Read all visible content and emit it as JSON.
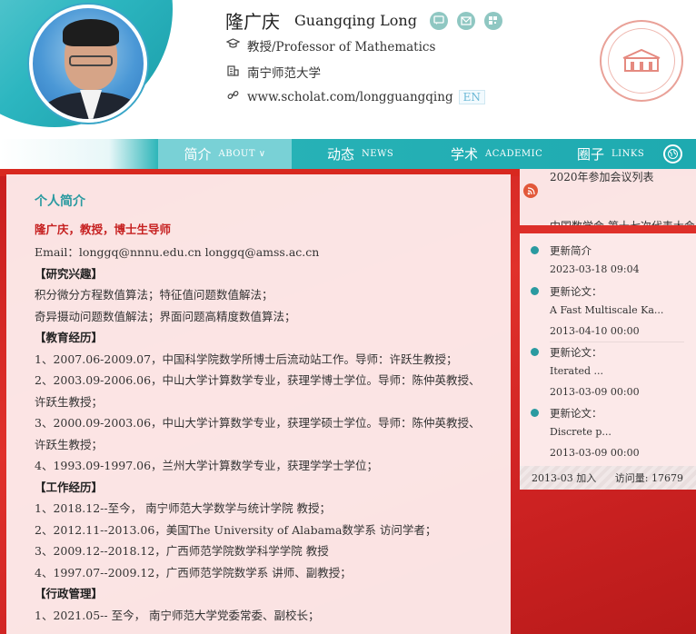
{
  "header": {
    "name_cn": "隆广庆",
    "name_en": "Guangqing Long",
    "icons": [
      "chat-icon",
      "mail-icon",
      "qrcode-icon"
    ],
    "title": "教授/Professor of Mathematics",
    "university": "南宁师范大学",
    "url": "www.scholat.com/longguangqing",
    "lang_tag": "EN"
  },
  "nav": {
    "items": [
      {
        "cn": "简介",
        "en": "ABOUT ∨"
      },
      {
        "cn": "动态",
        "en": "NEWS"
      },
      {
        "cn": "学术",
        "en": "ACADEMIC"
      },
      {
        "cn": "圈子",
        "en": "LINKS"
      }
    ]
  },
  "main": {
    "section_title": "个人简介",
    "intro_name": "隆广庆，教授，博士生导师",
    "email": "Email：longgq@nnnu.edu.cn   longgq@amss.ac.cn",
    "research_heading": "【研究兴趣】",
    "research": [
      "积分微分方程数值算法；特征值问题数值解法；",
      "奇异摄动问题数值解法；界面问题高精度数值算法；"
    ],
    "education_heading": "【教育经历】",
    "education": [
      "1、2007.06-2009.07，中国科学院数学所博士后流动站工作。导师：许跃生教授；",
      "2、2003.09-2006.06，中山大学计算数学专业，获理学博士学位。导师：陈仲英教授、许跃生教授；",
      "3、2000.09-2003.06，中山大学计算数学专业，获理学硕士学位。导师：陈仲英教授、许跃生教授；",
      "4、1993.09-1997.06，兰州大学计算数学专业，获理学学士学位；"
    ],
    "work_heading": "【工作经历】",
    "work": [
      "1、2018.12--至今，    南宁师范大学数学与统计学院 教授；",
      "2、2012.11--2013.06，美国The University of Alabama数学系 访问学者；",
      "3、2009.12--2018.12，广西师范学院数学科学学院  教授",
      "4、1997.07--2009.12，广西师范学院数学系  讲师、副教授；"
    ],
    "admin_heading": "【行政管理】",
    "admin": [
      "1、2021.05-- 至今，    南宁师范大学党委常委、副校长；"
    ]
  },
  "rss": {
    "item1": "2020年参加会议列表",
    "item2": "中国数学会 第十七次代表大会"
  },
  "updates": [
    {
      "type": "更新简介",
      "detail": "",
      "date": "2023-03-18 09:04"
    },
    {
      "type": "更新论文：",
      "detail": "A Fast Multiscale Ka...",
      "date": "2013-04-10 00:00"
    },
    {
      "type": "更新论文：",
      "detail": "Iterated ...",
      "date": "2013-03-09 00:00"
    },
    {
      "type": "更新论文：",
      "detail": "Discrete p...",
      "date": "2013-03-09 00:00"
    }
  ],
  "stats": {
    "joined": "2013-03 加入",
    "visits": "访问量: 17679"
  },
  "colors": {
    "teal": "#2ab4b8",
    "accent_red": "#c62020",
    "background_red": "#d8281f"
  }
}
